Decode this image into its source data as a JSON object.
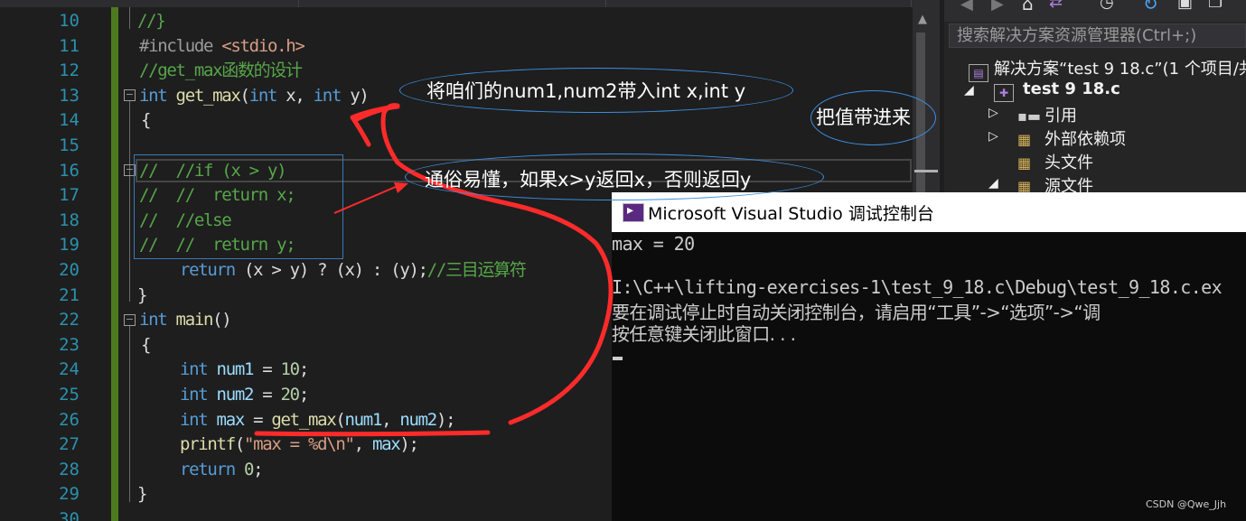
{
  "editor": {
    "line_numbers": [
      "10",
      "11",
      "12",
      "13",
      "14",
      "15",
      "16",
      "17",
      "18",
      "19",
      "20",
      "21",
      "22",
      "23",
      "24",
      "25",
      "26",
      "27",
      "28",
      "29",
      "30"
    ],
    "lines": {
      "l10": "//}",
      "l11_a": "#include ",
      "l11_b": "<stdio.h>",
      "l12": "//get_max函数的设计",
      "l13_kw": "int",
      "l13_fn": " get_max",
      "l13_rest_a": "(",
      "l13_kw2": "int",
      "l13_rest_b": " x, ",
      "l13_kw3": "int",
      "l13_rest_c": " y)",
      "l14": "{",
      "l16": "//  //if (x > y)",
      "l17": "//  //  return x;",
      "l18": "//  //else",
      "l19": "//  //  return y;",
      "l20_kw": "return",
      "l20_rest": " (x > y) ? (x) : (y);",
      "l20_cm": "//三目运算符",
      "l21": "}",
      "l22_kw": "int",
      "l22_fn": " main",
      "l22_rest": "()",
      "l23": "{",
      "l24_kw": "int",
      "l24_var": " num1",
      "l24_rest": " = ",
      "l24_num": "10",
      "l24_end": ";",
      "l25_kw": "int",
      "l25_var": " num2",
      "l25_rest": " = ",
      "l25_num": "20",
      "l25_end": ";",
      "l26_kw": "int",
      "l26_var": " max",
      "l26_rest": " = ",
      "l26_fn": "get_max",
      "l26_args_a": "(",
      "l26_args_v1": "num1",
      "l26_args_b": ", ",
      "l26_args_v2": "num2",
      "l26_args_c": ");",
      "l27_fn": "printf",
      "l27_a": "(",
      "l27_str": "\"max = %d\\n\"",
      "l27_b": ", ",
      "l27_var": "max",
      "l27_c": ");",
      "l28_kw": "return",
      "l28_rest": " ",
      "l28_num": "0",
      "l28_end": ";",
      "l29": "}"
    }
  },
  "solution_explorer": {
    "search_placeholder": "搜索解决方案资源管理器(Ctrl+;)",
    "items": [
      {
        "label": "解决方案“test 9 18.c”(1 个项目/共"
      },
      {
        "label": "test 9 18.c"
      },
      {
        "label": "引用"
      },
      {
        "label": "外部依赖项"
      },
      {
        "label": "头文件"
      },
      {
        "label": "源文件"
      }
    ]
  },
  "console": {
    "title": "Microsoft Visual Studio 调试控制台",
    "lines": [
      "max = 20",
      "",
      "I:\\C++\\lifting-exercises-1\\test_9_18.c\\Debug\\test_9_18.c.ex",
      "要在调试停止时自动关闭控制台，请启用“工具”->“选项”->“调",
      "按任意键关闭此窗口. . ."
    ]
  },
  "annotations": {
    "a1": "将咱们的num1,num2带入int x,int y",
    "a2": "把值带进来",
    "a3": "通俗易懂，如果x>y返回x，否则返回y"
  },
  "watermark": "CSDN @Qwe_Jjh",
  "colors": {
    "keyword": "#569cd6",
    "comment": "#57a64a",
    "function": "#dcdcaa",
    "string": "#d69d85",
    "variable": "#9cdcfe",
    "number": "#b5cea8",
    "red_marker": "#ff2b2b",
    "annotation_ellipse": "#3b8ee0"
  }
}
